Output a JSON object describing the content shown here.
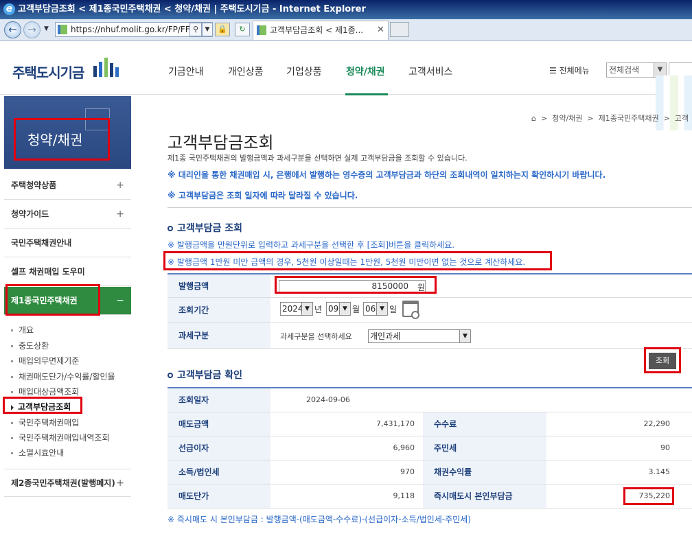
{
  "browser": {
    "window_title": "고객부담금조회 < 제1종국민주택채권 < 청약/채권 | 주택도시기금 - Internet Explorer",
    "url": "https://nhuf.molit.go.kr/FP/FF",
    "tab_title": "고객부담금조회 < 제1종..."
  },
  "header": {
    "logo": "주택도시기금",
    "nav": [
      "기금안내",
      "개인상품",
      "기업상품",
      "청약/채권",
      "고객서비스"
    ],
    "all_menu": "전체메뉴",
    "search_scope": "전체검색"
  },
  "sidebar": {
    "title": "청약/채권",
    "items": [
      {
        "label": "주택청약상품",
        "toggle": "+"
      },
      {
        "label": "청약가이드",
        "toggle": "+"
      },
      {
        "label": "국민주택채권안내",
        "toggle": ""
      },
      {
        "label": "셀프 채권매입 도우미",
        "toggle": ""
      },
      {
        "label": "제1종국민주택채권",
        "toggle": "−"
      }
    ],
    "subitems": [
      "개요",
      "중도상환",
      "매입의무면제기준",
      "채권매도단가/수익률/할인율",
      "매입대상금액조회",
      "고객부담금조회",
      "국민주택채권매입",
      "국민주택채권매입내역조회",
      "소멸시효안내"
    ],
    "bottom_item": {
      "label": "제2종국민주택채권(발행폐지)",
      "toggle": "+"
    }
  },
  "breadcrumb": [
    "청약/채권",
    "제1종국민주택채권",
    "고객"
  ],
  "page": {
    "title": "고객부담금조회",
    "description": "제1종 국민주택채권의 발행금액과 과세구분을 선택하면 실제 고객부담금을 조회할 수 있습니다.",
    "notice1": "※ 대리인을 통한 채권매입 시, 은행에서 발행하는 영수증의 고객부담금과 하단의 조회내역이 일치하는지 확인하시기 바랍니다.",
    "notice2": "※ 고객부담금은 조회 일자에 따라 달라질 수 있습니다."
  },
  "query": {
    "section_title": "고객부담금 조회",
    "note1": "※ 발행금액을 만원단위로 입력하고 과세구분을 선택한 후 [조회]버튼을 클릭하세요.",
    "note2": "※ 발행금액 1만원 미만 금액의 경우, 5천원 이상일때는 1만원, 5천원 미만이면 없는 것으로 계산하세요.",
    "amount_label": "발행금액",
    "amount_value": "8150000",
    "amount_unit": "원",
    "period_label": "조회기간",
    "year": "2024",
    "year_unit": "년",
    "month": "09",
    "month_unit": "월",
    "day": "06",
    "day_unit": "일",
    "tax_label": "과세구분",
    "tax_hint": "과세구분을 선택하세요",
    "tax_value": "개인과세",
    "query_button": "조회"
  },
  "result": {
    "section_title": "고객부담금 확인",
    "date_label": "조회일자",
    "date_value": "2024-09-06",
    "rows": [
      {
        "l1": "매도금액",
        "v1": "7,431,170",
        "l2": "수수료",
        "v2": "22,290"
      },
      {
        "l1": "선급이자",
        "v1": "6,960",
        "l2": "주민세",
        "v2": "90"
      },
      {
        "l1": "소득/법인세",
        "v1": "970",
        "l2": "채권수익률",
        "v2": "3.145"
      },
      {
        "l1": "매도단가",
        "v1": "9,118",
        "l2": "즉시매도시 본인부담금",
        "v2": "735,220"
      }
    ],
    "formula": "※ 즉시매도 시 본인부담금 : 발행금액-(매도금액-수수료)-(선급이자-소득/법인세-주민세)"
  }
}
